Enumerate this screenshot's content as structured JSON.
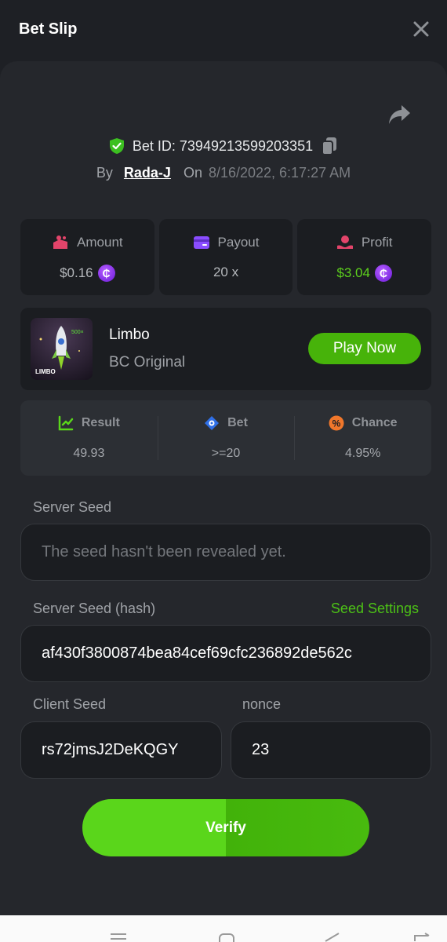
{
  "header": {
    "title": "Bet Slip",
    "close_icon": "close-icon"
  },
  "bet": {
    "id_text": "Bet ID: 73949213599203351",
    "by_label": "By",
    "user": "Rada-J",
    "on_label": "On",
    "date": "8/16/2022, 6:17:27 AM"
  },
  "stats": {
    "amount_label": "Amount",
    "amount_value": "$0.16",
    "payout_label": "Payout",
    "payout_value": "20 x",
    "profit_label": "Profit",
    "profit_value": "$3.04",
    "coin_symbol": "₵"
  },
  "game": {
    "name": "Limbo",
    "subtitle": "BC Original",
    "play_label": "Play Now",
    "thumb_text": "LIMBO",
    "thumb_badge": "500×"
  },
  "result": {
    "result_label": "Result",
    "result_value": "49.93",
    "bet_label": "Bet",
    "bet_value": ">=20",
    "chance_label": "Chance",
    "chance_value": "4.95%"
  },
  "seeds": {
    "server_seed_label": "Server Seed",
    "server_seed_placeholder": "The seed hasn't been revealed yet.",
    "server_hash_label": "Server Seed (hash)",
    "seed_settings_label": "Seed Settings",
    "server_hash_value": "af430f3800874bea84cef69cfc236892de562c",
    "client_seed_label": "Client Seed",
    "client_seed_value": "rs72jmsJ2DeKQGY",
    "nonce_label": "nonce",
    "nonce_value": "23"
  },
  "verify_label": "Verify",
  "colors": {
    "accent": "#5ad61b",
    "profit": "#5dd11d",
    "panel": "#25272c",
    "card": "#1b1d21"
  }
}
